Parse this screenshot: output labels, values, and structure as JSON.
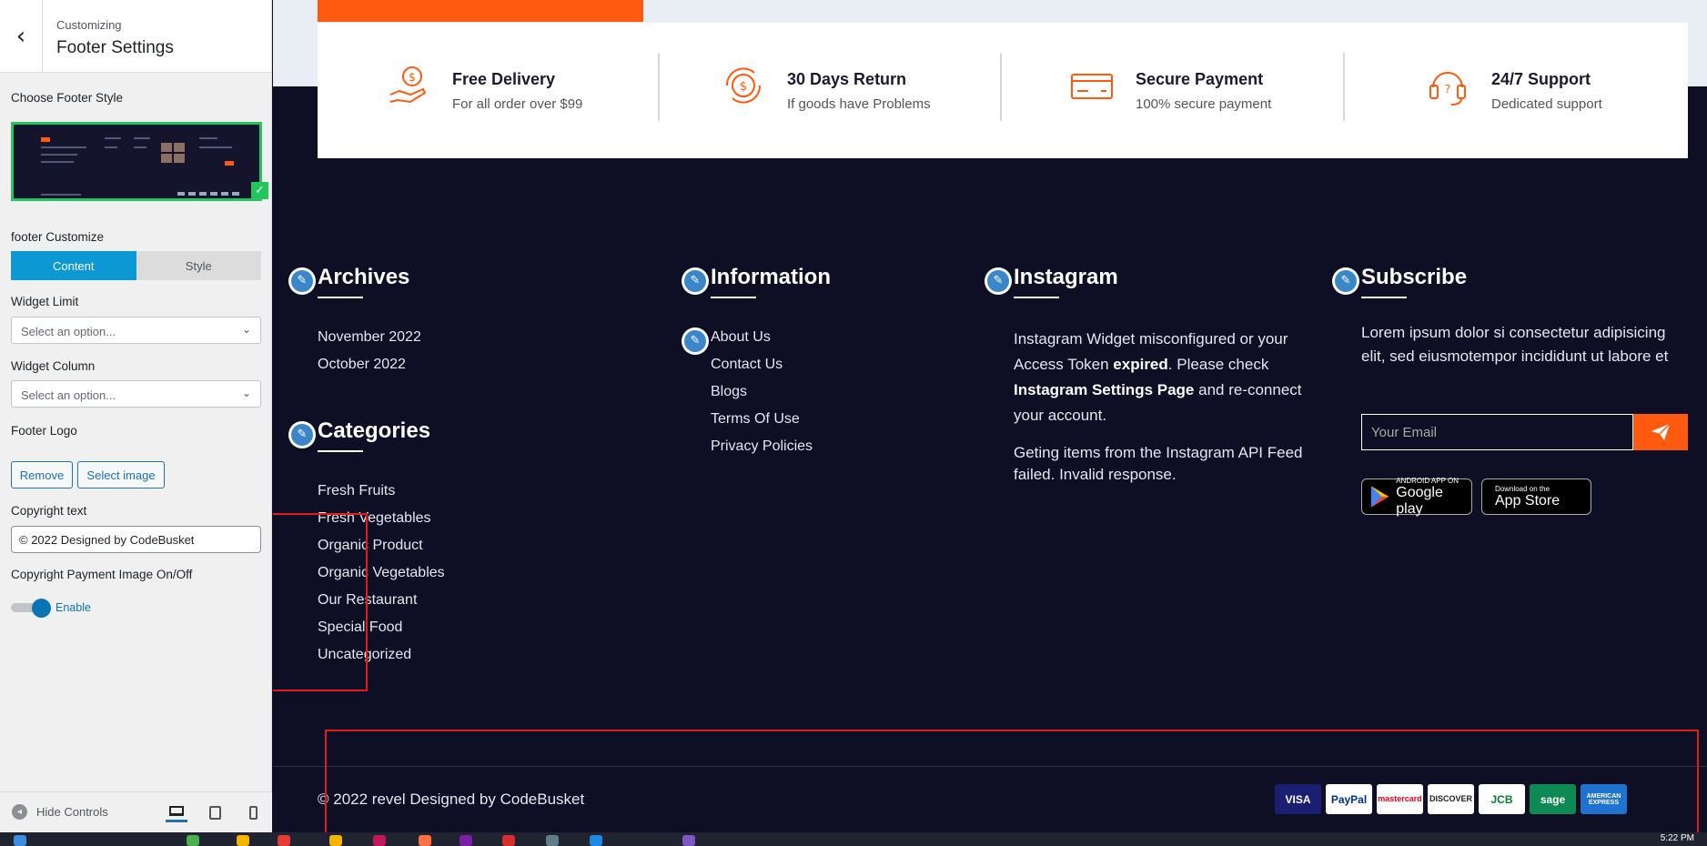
{
  "customizer": {
    "breadcrumb": "Customizing",
    "title": "Footer Settings",
    "choose_style_label": "Choose Footer Style",
    "customize_label": "footer Customize",
    "tabs": [
      "Content",
      "Style"
    ],
    "widget_limit_label": "Widget Limit",
    "widget_limit_placeholder": "Select an option...",
    "widget_column_label": "Widget Column",
    "widget_column_placeholder": "Select an option...",
    "footer_logo_label": "Footer Logo",
    "remove_label": "Remove",
    "select_image_label": "Select image",
    "copyright_label": "Copyright text",
    "copyright_value": "© 2022 Designed by CodeBusket",
    "payment_toggle_label": "Copyright Payment Image On/Off",
    "payment_toggle_state": "Enable",
    "hide_controls_label": "Hide Controls"
  },
  "preview": {
    "features": [
      {
        "icon": "delivery-hand-icon",
        "title": "Free Delivery",
        "subtitle": "For all order over $99"
      },
      {
        "icon": "return-cycle-icon",
        "title": "30 Days Return",
        "subtitle": "If goods have Problems"
      },
      {
        "icon": "credit-card-icon",
        "title": "Secure Payment",
        "subtitle": "100% secure payment"
      },
      {
        "icon": "headset-icon",
        "title": "24/7 Support",
        "subtitle": "Dedicated support"
      }
    ],
    "archives": {
      "title": "Archives",
      "items": [
        "November 2022",
        "October 2022"
      ]
    },
    "categories": {
      "title": "Categories",
      "items": [
        "Fresh Fruits",
        "Fresh Vegetables",
        "Organic Product",
        "Organic Vegetables",
        "Our Restaurant",
        "Special Food",
        "Uncategorized"
      ]
    },
    "information": {
      "title": "Information",
      "items": [
        "About Us",
        "Contact Us",
        "Blogs",
        "Terms Of Use",
        "Privacy Policies"
      ]
    },
    "instagram": {
      "title": "Instagram",
      "msg_part1": "Instagram Widget misconfigured or your Access Token ",
      "msg_bold1": "expired",
      "msg_part2": ". Please check ",
      "msg_bold2": "Instagram Settings Page",
      "msg_part3": " and re-connect your account.",
      "msg2": "Geting items from the Instagram API Feed failed. Invalid response."
    },
    "subscribe": {
      "title": "Subscribe",
      "text": "Lorem ipsum dolor si consectetur adipisicing elit, sed eiusmotempor incididunt ut labore et",
      "email_placeholder": "Your Email",
      "google_play_small": "ANDROID APP ON",
      "google_play_big": "Google play",
      "app_store_small": "Download on the",
      "app_store_big": "App Store"
    },
    "copyright": "© 2022 revel Designed by CodeBusket",
    "payments": [
      {
        "name": "VISA",
        "bg": "#1a1f71",
        "fg": "#ffffff"
      },
      {
        "name": "PayPal",
        "bg": "#ffffff",
        "fg": "#003087"
      },
      {
        "name": "mastercard",
        "bg": "#ffffff",
        "fg": "#eb001b"
      },
      {
        "name": "DISCOVER",
        "bg": "#ffffff",
        "fg": "#222222"
      },
      {
        "name": "JCB",
        "bg": "#ffffff",
        "fg": "#0b7a3b"
      },
      {
        "name": "sage",
        "bg": "#0d8a53",
        "fg": "#ffffff"
      },
      {
        "name": "AMERICAN EXPRESS",
        "bg": "#1f72cd",
        "fg": "#ffffff"
      }
    ]
  },
  "taskbar": {
    "time": "5:22 PM"
  },
  "colors": {
    "accent_orange": "#ff5a0f",
    "customizer_blue": "#0b98d3",
    "footer_bg": "#0e0e24",
    "highlight_red": "#e01b1b"
  }
}
